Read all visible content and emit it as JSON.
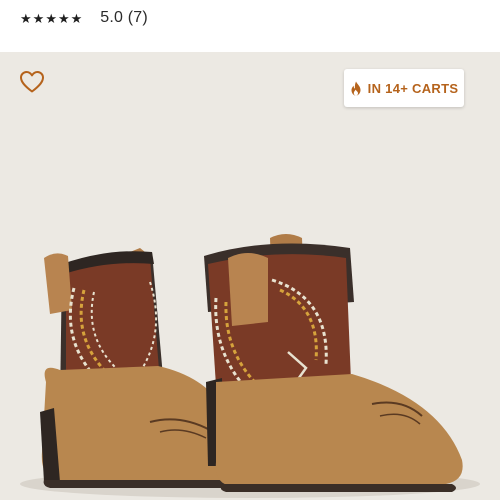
{
  "rating": {
    "stars": [
      "★",
      "★",
      "★",
      "★",
      "★"
    ],
    "text": "5.0 (7)"
  },
  "media": {
    "background": "#ece9e3",
    "favorite_icon": "heart-outline-icon",
    "badge": {
      "icon": "flame-icon",
      "label": "IN 14+ CARTS",
      "color": "#b5631c"
    },
    "image_subject": "baby-cowboy-boots"
  }
}
